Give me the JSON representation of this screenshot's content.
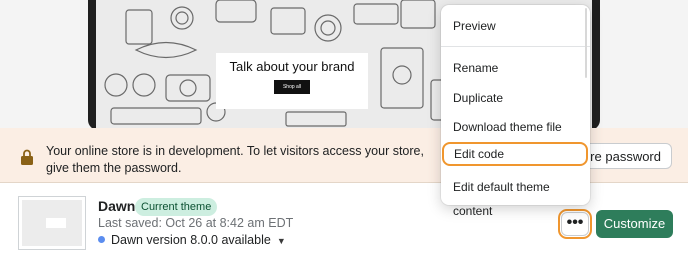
{
  "preview": {
    "brand_title": "Talk about your brand",
    "shop_button": "Shop all"
  },
  "banner": {
    "message": "Your online store is in development. To let visitors access your store, give them the password.",
    "store_password_button": "store password"
  },
  "theme": {
    "name": "Dawn",
    "badge": "Current theme",
    "last_saved": "Last saved: Oct 26 at 8:42 am EDT",
    "version": "Dawn version 8.0.0 available",
    "more_button": "•••",
    "customize_button": "Customize"
  },
  "menu": {
    "items": [
      {
        "label": "Preview"
      },
      {
        "label": "Rename"
      },
      {
        "label": "Duplicate"
      },
      {
        "label": "Download theme file"
      },
      {
        "label": "Edit code"
      },
      {
        "label": "Edit default theme content"
      }
    ]
  },
  "colors": {
    "highlight": "#f0962e",
    "primary": "#2e7d5b",
    "badge_bg": "#cdeee0",
    "banner_bg": "#fbeee4"
  }
}
